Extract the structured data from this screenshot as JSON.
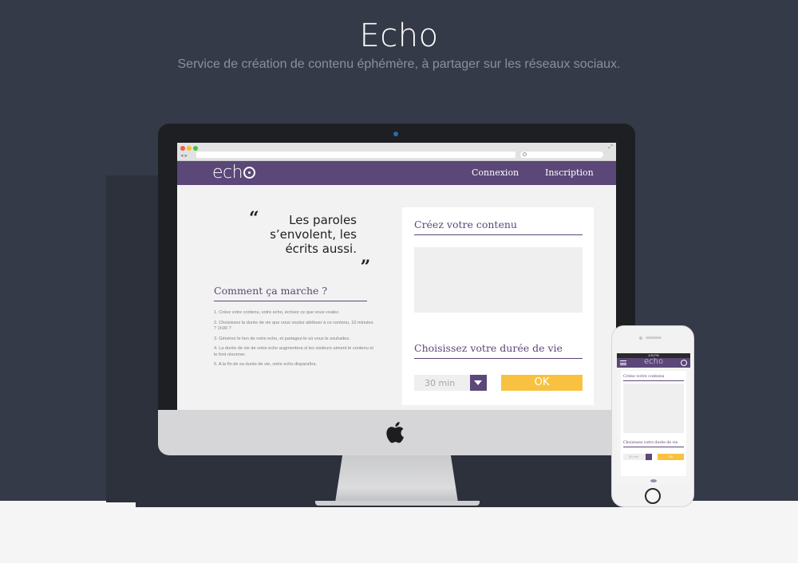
{
  "page": {
    "title": "Echo",
    "subtitle": "Service de création de contenu éphémère, à partager sur les réseaux sociaux."
  },
  "colors": {
    "background": "#343a47",
    "brand_purple": "#5b4778",
    "accent_yellow": "#f8c240"
  },
  "site": {
    "logo": "ech",
    "nav": {
      "connexion": "Connexion",
      "inscription": "Inscription"
    },
    "quote": {
      "open_mark": "“",
      "text_line1": "Les paroles",
      "text_line2": "s’envolent, les",
      "text_line3": "écrits aussi.",
      "close_mark": "„"
    },
    "how_it_works": {
      "title": "Comment ça marche ?",
      "steps": [
        "1. Créez votre contenu, votre echo, écrivez ce que vous voulez.",
        "2. Choisissez la durée de vie que vous voulez attribuer à ce contenu, 10 minutes ? 1h30 ?",
        "3. Générez le lien de votre echo, et partagez-le où vous le souhaitez.",
        "4. La durée de vie de votre echo augmentera si les visiteurs aiment le contenu et le font résonner.",
        "5. A la fin de sa durée de vie, votre echo disparaîtra."
      ]
    },
    "create": {
      "title": "Créez votre contenu",
      "content_value": ""
    },
    "duration": {
      "title": "Choisissez votre durée de vie",
      "selected": "30 min",
      "ok_label": "OK"
    }
  },
  "mobile": {
    "status": "4:20 PM",
    "logo": "echo",
    "create_title": "Créez votre contenu",
    "duration_title": "Choisissez votre durée de vie",
    "selected": "30 min",
    "ok_label": "OK"
  }
}
